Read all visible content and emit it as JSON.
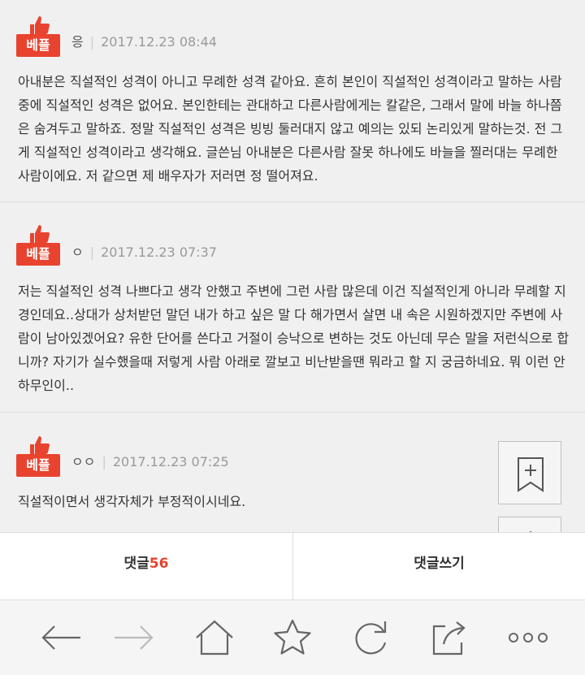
{
  "comments": [
    {
      "badge": "베플",
      "nickname": "응",
      "timestamp": "2017.12.23 08:44",
      "text": "아내분은 직설적인 성격이 아니고 무례한 성격 같아요. 흔히 본인이 직설적인 성격이라고 말하는 사람중에 직설적인 성격은 없어요. 본인한테는 관대하고 다른사람에게는 칼같은, 그래서 말에 바늘 하나쯤은 숨겨두고 말하죠. 정말 직설적인 성격은 빙빙 둘러대지 않고 예의는 있되 논리있게 말하는것. 전 그게 직설적인 성격이라고 생각해요. 글쓴님 아내분은 다른사람 잘못 하나에도 바늘을 찔러대는 무례한 사람이에요. 저 같으면 제 배우자가 저러면 정 떨어져요."
    },
    {
      "badge": "베플",
      "nickname": "ㅇ",
      "timestamp": "2017.12.23 07:37",
      "text": "저는 직설적인 성격 나쁘다고 생각 안했고 주변에 그런 사람 많은데 이건 직설적인게 아니라 무례할 지경인데요..상대가 상처받던 말던 내가 하고 싶은 말 다 해가면서 살면 내 속은 시원하겠지만 주변에 사람이 남아있겠어요? 유한 단어를 쓴다고 거절이 승낙으로 변하는 것도 아닌데 무슨 말을 저런식으로 합니까? 자기가 실수했을때 저렇게 사람 아래로 깔보고 비난받을땐 뭐라고 할 지 궁금하네요. 뭐 이런 안하무인이.."
    },
    {
      "badge": "베플",
      "nickname": "ㅇㅇ",
      "timestamp": "2017.12.23 07:25",
      "text": "직설적이면서 생각자체가 부정적이시네요."
    }
  ],
  "tabs": {
    "comments_label": "댓글",
    "comments_count": "56",
    "write_label": "댓글쓰기"
  },
  "floating": {
    "bookmark_icon": "bookmark-plus-icon",
    "top_icon": "arrow-up-icon"
  },
  "browser_toolbar": [
    {
      "icon": "back-arrow-icon"
    },
    {
      "icon": "forward-arrow-icon"
    },
    {
      "icon": "home-icon"
    },
    {
      "icon": "star-icon"
    },
    {
      "icon": "refresh-icon"
    },
    {
      "icon": "share-icon"
    },
    {
      "icon": "more-icon"
    }
  ],
  "colors": {
    "accent": "#e8432f",
    "background": "#f0f0f0"
  }
}
